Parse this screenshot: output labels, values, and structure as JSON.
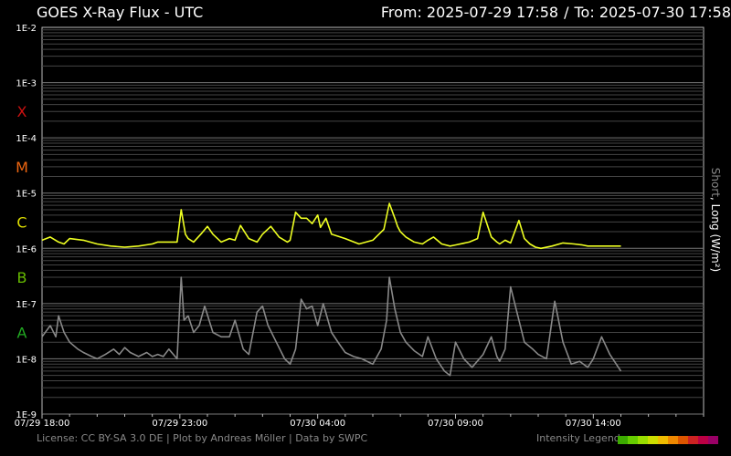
{
  "title": "GOES X-Ray Flux - UTC",
  "range": {
    "from": "From: 2025-07-29 17:58",
    "sep": "/",
    "to": "To: 2025-07-30 17:58"
  },
  "ylabel": {
    "short": "Short",
    "rest": ", Long (W/m²)"
  },
  "footer": "License: CC BY-SA 3.0 DE | Plot by Andreas Möller | Data by SWPC",
  "legend_label": "Intensity Legend",
  "legend_colors": [
    "#3caa00",
    "#66cc00",
    "#99dd00",
    "#ccdd00",
    "#eebb00",
    "#ee8800",
    "#dd5500",
    "#cc2222",
    "#bb0044",
    "#990066"
  ],
  "chart_data": {
    "type": "line",
    "title": "GOES X-Ray Flux - UTC",
    "ylabel": "Short, Long (W/m²)",
    "yscale": "log",
    "ylim": [
      1e-09,
      0.01
    ],
    "xlim": [
      0,
      24
    ],
    "x_unit": "hours after 2025-07-29 18:00 UTC",
    "grid": true,
    "ytick_labels": [
      {
        "v": 0.01,
        "label": "1E-2"
      },
      {
        "v": 0.001,
        "label": "1E-3"
      },
      {
        "v": 0.0001,
        "label": "1E-4"
      },
      {
        "v": 1e-05,
        "label": "1E-5"
      },
      {
        "v": 1e-06,
        "label": "1E-6"
      },
      {
        "v": 1e-07,
        "label": "1E-7"
      },
      {
        "v": 1e-08,
        "label": "1E-8"
      },
      {
        "v": 1e-09,
        "label": "1E-9"
      }
    ],
    "xtick_labels": [
      {
        "v": 0,
        "label": "07/29 18:00"
      },
      {
        "v": 5,
        "label": "07/29 23:00"
      },
      {
        "v": 10,
        "label": "07/30 04:00"
      },
      {
        "v": 15,
        "label": "07/30 09:00"
      },
      {
        "v": 20,
        "label": "07/30 14:00"
      }
    ],
    "flare_classes": [
      {
        "label": "X",
        "v": 0.0003,
        "color": "#cc1111"
      },
      {
        "label": "M",
        "v": 3e-05,
        "color": "#ee6611"
      },
      {
        "label": "C",
        "v": 3e-06,
        "color": "#dddd00"
      },
      {
        "label": "B",
        "v": 3e-07,
        "color": "#66bb00"
      },
      {
        "label": "A",
        "v": 3e-08,
        "color": "#22aa22"
      }
    ],
    "series": [
      {
        "name": "Long",
        "color": "#eeff22",
        "x": [
          0.0,
          0.3,
          0.6,
          0.8,
          1.0,
          1.5,
          2.0,
          2.5,
          3.0,
          3.5,
          4.0,
          4.2,
          4.9,
          5.05,
          5.2,
          5.3,
          5.5,
          5.8,
          6.0,
          6.2,
          6.5,
          6.8,
          7.0,
          7.2,
          7.5,
          7.8,
          8.0,
          8.3,
          8.6,
          8.9,
          9.0,
          9.2,
          9.4,
          9.6,
          9.8,
          10.0,
          10.1,
          10.3,
          10.5,
          11.0,
          11.5,
          12.0,
          12.4,
          12.6,
          12.8,
          12.9,
          13.0,
          13.2,
          13.5,
          13.8,
          14.0,
          14.2,
          14.5,
          14.8,
          15.0,
          15.5,
          15.8,
          16.0,
          16.3,
          16.5,
          16.6,
          16.8,
          17.0,
          17.3,
          17.5,
          17.7,
          17.9,
          18.1,
          18.5,
          18.9,
          19.3,
          19.6,
          19.8,
          20.0,
          20.5,
          21.0
        ],
        "y": [
          1.4e-06,
          1.6e-06,
          1.3e-06,
          1.2e-06,
          1.5e-06,
          1.4e-06,
          1.2e-06,
          1.1e-06,
          1.05e-06,
          1.1e-06,
          1.2e-06,
          1.3e-06,
          1.3e-06,
          5e-06,
          1.8e-06,
          1.5e-06,
          1.3e-06,
          1.9e-06,
          2.5e-06,
          1.8e-06,
          1.3e-06,
          1.5e-06,
          1.4e-06,
          2.6e-06,
          1.5e-06,
          1.3e-06,
          1.8e-06,
          2.5e-06,
          1.6e-06,
          1.3e-06,
          1.4e-06,
          4.5e-06,
          3.5e-06,
          3.5e-06,
          2.8e-06,
          4e-06,
          2.4e-06,
          3.5e-06,
          1.8e-06,
          1.5e-06,
          1.2e-06,
          1.4e-06,
          2.2e-06,
          6.5e-06,
          3.5e-06,
          2.5e-06,
          2e-06,
          1.6e-06,
          1.3e-06,
          1.2e-06,
          1.4e-06,
          1.6e-06,
          1.2e-06,
          1.1e-06,
          1.15e-06,
          1.3e-06,
          1.5e-06,
          4.5e-06,
          1.6e-06,
          1.3e-06,
          1.2e-06,
          1.4e-06,
          1.25e-06,
          3.2e-06,
          1.5e-06,
          1.2e-06,
          1.05e-06,
          1e-06,
          1.1e-06,
          1.25e-06,
          1.2e-06,
          1.15e-06,
          1.1e-06,
          1.1e-06,
          1.1e-06,
          1.1e-06
        ]
      },
      {
        "name": "Short",
        "color": "#888888",
        "x": [
          0.0,
          0.3,
          0.5,
          0.6,
          0.8,
          1.0,
          1.3,
          1.5,
          1.8,
          2.0,
          2.3,
          2.6,
          2.8,
          3.0,
          3.2,
          3.5,
          3.8,
          4.0,
          4.2,
          4.4,
          4.6,
          4.9,
          5.05,
          5.15,
          5.3,
          5.5,
          5.7,
          5.9,
          6.2,
          6.5,
          6.8,
          7.0,
          7.3,
          7.5,
          7.8,
          8.0,
          8.2,
          8.5,
          8.8,
          9.0,
          9.2,
          9.4,
          9.6,
          9.8,
          10.0,
          10.2,
          10.5,
          10.8,
          11.0,
          11.3,
          11.6,
          12.0,
          12.3,
          12.5,
          12.6,
          12.8,
          13.0,
          13.2,
          13.5,
          13.8,
          14.0,
          14.3,
          14.6,
          14.8,
          15.0,
          15.3,
          15.6,
          16.0,
          16.3,
          16.5,
          16.6,
          16.8,
          17.0,
          17.3,
          17.5,
          17.8,
          18.0,
          18.3,
          18.6,
          18.9,
          19.2,
          19.5,
          19.8,
          20.0,
          20.3,
          20.6,
          21.0
        ],
        "y": [
          2.5e-08,
          4e-08,
          2.5e-08,
          6e-08,
          3e-08,
          2e-08,
          1.5e-08,
          1.3e-08,
          1.1e-08,
          1e-08,
          1.2e-08,
          1.5e-08,
          1.2e-08,
          1.6e-08,
          1.3e-08,
          1.1e-08,
          1.3e-08,
          1.1e-08,
          1.2e-08,
          1.1e-08,
          1.5e-08,
          1e-08,
          3e-07,
          5e-08,
          6e-08,
          3e-08,
          4e-08,
          9e-08,
          3e-08,
          2.5e-08,
          2.5e-08,
          5e-08,
          1.5e-08,
          1.2e-08,
          7e-08,
          9e-08,
          4e-08,
          2e-08,
          1e-08,
          8e-09,
          1.5e-08,
          1.2e-07,
          8e-08,
          9e-08,
          4e-08,
          1e-07,
          3e-08,
          1.8e-08,
          1.3e-08,
          1.1e-08,
          1e-08,
          8e-09,
          1.5e-08,
          5e-08,
          3e-07,
          8e-08,
          3e-08,
          2e-08,
          1.4e-08,
          1.1e-08,
          2.5e-08,
          1e-08,
          6e-09,
          5e-09,
          2e-08,
          1e-08,
          7e-09,
          1.2e-08,
          2.5e-08,
          1.1e-08,
          9e-09,
          1.5e-08,
          2e-07,
          5e-08,
          2e-08,
          1.5e-08,
          1.2e-08,
          1e-08,
          1.1e-07,
          2e-08,
          8e-09,
          9e-09,
          7e-09,
          1e-08,
          2.5e-08,
          1.2e-08,
          6e-09
        ]
      }
    ]
  }
}
